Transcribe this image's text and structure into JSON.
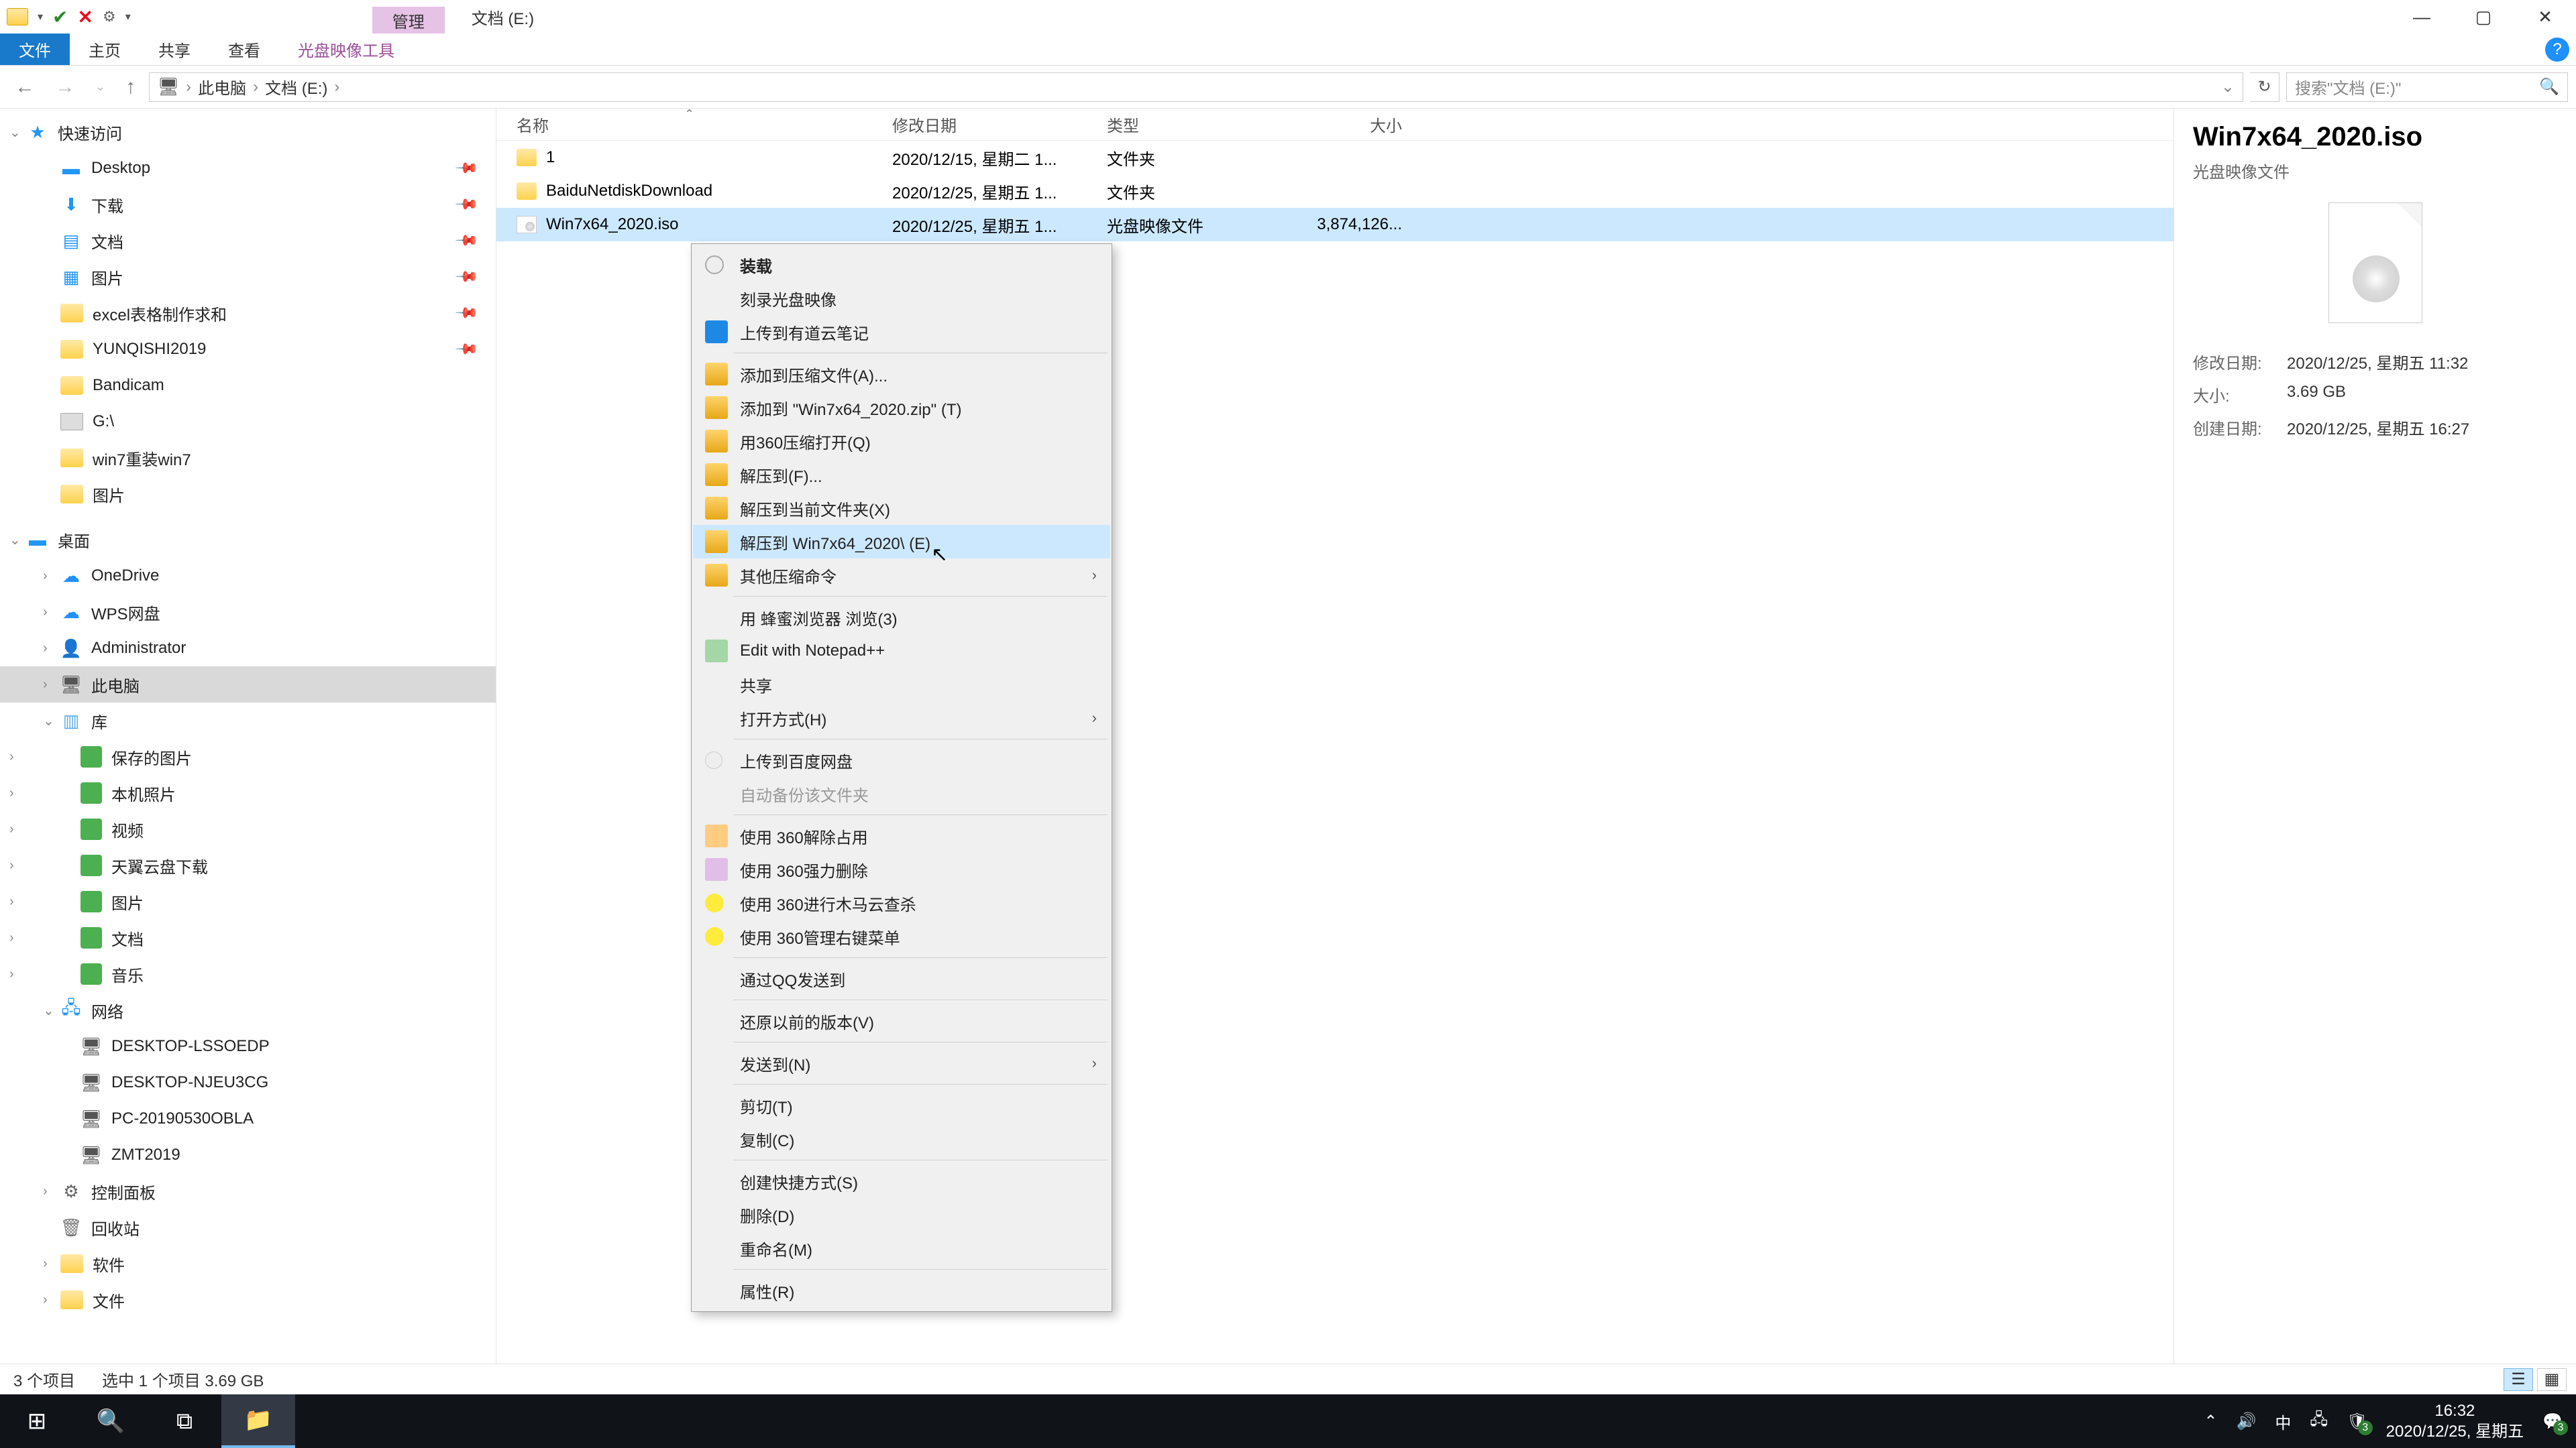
{
  "titlebar": {
    "contextual_tab": "管理",
    "title": "文档 (E:)",
    "min": "—",
    "max": "▢",
    "close": "✕"
  },
  "ribbon": {
    "file": "文件",
    "home": "主页",
    "share": "共享",
    "view": "查看",
    "tool": "光盘映像工具"
  },
  "address": {
    "root": "此电脑",
    "current": "文档 (E:)",
    "search_placeholder": "搜索\"文档 (E:)\""
  },
  "tree": {
    "quick": "快速访问",
    "quick_items": [
      "Desktop",
      "下载",
      "文档",
      "图片",
      "excel表格制作求和",
      "YUNQISHI2019",
      "Bandicam",
      "G:\\",
      "win7重装win7",
      "图片"
    ],
    "desktop": "桌面",
    "desktop_items": [
      "OneDrive",
      "WPS网盘",
      "Administrator",
      "此电脑",
      "库"
    ],
    "lib_items": [
      "保存的图片",
      "本机照片",
      "视频",
      "天翼云盘下载",
      "图片",
      "文档",
      "音乐"
    ],
    "network": "网络",
    "net_items": [
      "DESKTOP-LSSOEDP",
      "DESKTOP-NJEU3CG",
      "PC-20190530OBLA",
      "ZMT2019"
    ],
    "ctrl": "控制面板",
    "bin": "回收站",
    "soft": "软件",
    "docfolder": "文件"
  },
  "columns": {
    "name": "名称",
    "date": "修改日期",
    "type": "类型",
    "size": "大小"
  },
  "files": [
    {
      "name": "1",
      "date": "2020/12/15, 星期二 1...",
      "type": "文件夹",
      "size": "",
      "icon": "folder"
    },
    {
      "name": "BaiduNetdiskDownload",
      "date": "2020/12/25, 星期五 1...",
      "type": "文件夹",
      "size": "",
      "icon": "folder"
    },
    {
      "name": "Win7x64_2020.iso",
      "date": "2020/12/25, 星期五 1...",
      "type": "光盘映像文件",
      "size": "3,874,126...",
      "icon": "iso",
      "selected": true
    }
  ],
  "context": [
    {
      "label": "装载",
      "icon": "disc",
      "bold": true
    },
    {
      "label": "刻录光盘映像"
    },
    {
      "label": "上传到有道云笔记",
      "icon": "blue"
    },
    {
      "sep": true
    },
    {
      "label": "添加到压缩文件(A)...",
      "icon": "zip"
    },
    {
      "label": "添加到 \"Win7x64_2020.zip\" (T)",
      "icon": "zip"
    },
    {
      "label": "用360压缩打开(Q)",
      "icon": "zip"
    },
    {
      "label": "解压到(F)...",
      "icon": "zip"
    },
    {
      "label": "解压到当前文件夹(X)",
      "icon": "zip"
    },
    {
      "label": "解压到 Win7x64_2020\\ (E)",
      "icon": "zip",
      "selected": true
    },
    {
      "label": "其他压缩命令",
      "icon": "zip",
      "sub": true
    },
    {
      "sep": true
    },
    {
      "label": "用 蜂蜜浏览器 浏览(3)",
      "icon": "bee"
    },
    {
      "label": "Edit with Notepad++",
      "icon": "npp"
    },
    {
      "label": "共享",
      "icon": "share"
    },
    {
      "label": "打开方式(H)",
      "sub": true
    },
    {
      "sep": true
    },
    {
      "label": "上传到百度网盘",
      "icon": "baidu"
    },
    {
      "label": "自动备份该文件夹",
      "disabled": true
    },
    {
      "sep": true
    },
    {
      "label": "使用 360解除占用",
      "icon": "org"
    },
    {
      "label": "使用 360强力删除",
      "icon": "purple"
    },
    {
      "label": "使用 360进行木马云查杀",
      "icon": "yel"
    },
    {
      "label": "使用 360管理右键菜单",
      "icon": "yel"
    },
    {
      "sep": true
    },
    {
      "label": "通过QQ发送到"
    },
    {
      "sep": true
    },
    {
      "label": "还原以前的版本(V)"
    },
    {
      "sep": true
    },
    {
      "label": "发送到(N)",
      "sub": true
    },
    {
      "sep": true
    },
    {
      "label": "剪切(T)"
    },
    {
      "label": "复制(C)"
    },
    {
      "sep": true
    },
    {
      "label": "创建快捷方式(S)"
    },
    {
      "label": "删除(D)"
    },
    {
      "label": "重命名(M)"
    },
    {
      "sep": true
    },
    {
      "label": "属性(R)"
    }
  ],
  "preview": {
    "name": "Win7x64_2020.iso",
    "type": "光盘映像文件",
    "rows": [
      {
        "label": "修改日期:",
        "value": "2020/12/25, 星期五 11:32"
      },
      {
        "label": "大小:",
        "value": "3.69 GB"
      },
      {
        "label": "创建日期:",
        "value": "2020/12/25, 星期五 16:27"
      }
    ]
  },
  "status": {
    "count": "3 个项目",
    "selection": "选中 1 个项目  3.69 GB"
  },
  "tray": {
    "ime": "中",
    "time": "16:32",
    "date": "2020/12/25, 星期五"
  }
}
